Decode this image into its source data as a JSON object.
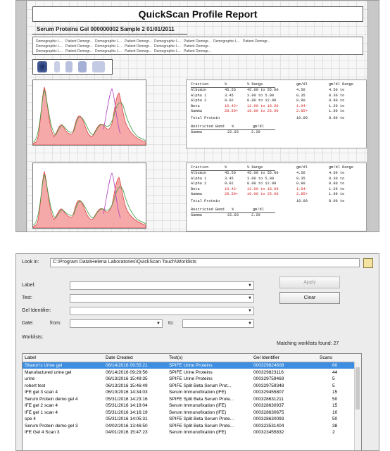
{
  "report": {
    "title": "QuickScan Profile Report",
    "subtitle": "Serum Proteins  Gel 000000002  Sample 2  01/01/2011",
    "demographics_row1": [
      "Demographic L...",
      "Patient Demogr...",
      "Demographic L...",
      "Patient Demogr...",
      "Demographic L...",
      "Patient Demogr...",
      "Demographic L...",
      "Patient Demogr..."
    ],
    "demographics_row2": [
      "Demographic L...",
      "Patient Demogr...",
      "Demographic L...",
      "Patient Demogr...",
      "Demographic L...",
      "Patient Demogr..."
    ],
    "demographics_row3": [
      "Demographic L...",
      "Patient Demogr...",
      "Demographic L...",
      "Patient Demogr...",
      "Demographic L...",
      "Patient Demogr..."
    ],
    "table_headers": [
      "Fraction",
      "%",
      "% Range",
      "gm/dl",
      "gm/dl Range"
    ],
    "tables": [
      {
        "rows": [
          {
            "fraction": "Albumin",
            "pct": "45.55",
            "range": "45.00 to  55.00",
            "gm": "4.56",
            "gmrange": "4.50 to",
            "abnormal": false
          },
          {
            "fraction": "Alpha 1",
            "pct": "3.45",
            "range": "3.00 to   5.00",
            "gm": "0.35",
            "gmrange": "0.30 to",
            "abnormal": false
          },
          {
            "fraction": "Alpha 2",
            "pct": "9.02",
            "range": "8.00 to  12.00",
            "gm": "0.90",
            "gmrange": "0.80 to",
            "abnormal": false
          },
          {
            "fraction": "Beta",
            "pct": "10.42+",
            "range": "12.00 to  18.00",
            "gm": "1.04-",
            "gmrange": "1.20 to",
            "abnormal": true
          },
          {
            "fraction": "Gamma",
            "pct": "28.50+",
            "range": "16.00 to  25.00",
            "gm": "2.85+",
            "gmrange": "1.60 to",
            "abnormal": true
          }
        ],
        "total_label": "Total Protein",
        "total_gm": "10.00",
        "total_range": "8.00 to",
        "restricted_label": "Restricted Band",
        "restricted_headers": [
          "%",
          "gm/dl"
        ],
        "restricted_fraction": "Gamma",
        "restricted_pct": "22.03",
        "restricted_gm": "2.20"
      },
      {
        "rows": [
          {
            "fraction": "Albumin",
            "pct": "45.50",
            "range": "45.00 to  55.00",
            "gm": "4.56",
            "gmrange": "4.50 to",
            "abnormal": false
          },
          {
            "fraction": "Alpha 1",
            "pct": "3.45",
            "range": "3.00 to   5.00",
            "gm": "0.35",
            "gmrange": "0.30 to",
            "abnormal": false
          },
          {
            "fraction": "Alpha 2",
            "pct": "9.02",
            "range": "8.00 to  12.00",
            "gm": "0.90",
            "gmrange": "0.80 to",
            "abnormal": false
          },
          {
            "fraction": "Beta",
            "pct": "10.42-",
            "range": "12.00 to  18.00",
            "gm": "1.04-",
            "gmrange": "1.20 to",
            "abnormal": true
          },
          {
            "fraction": "Gamma",
            "pct": "28.50+",
            "range": "16.00 to  25.00",
            "gm": "2.85+",
            "gmrange": "1.60 to",
            "abnormal": true
          }
        ],
        "total_label": "Total Protein",
        "total_gm": "10.00",
        "total_range": "8.00 to",
        "restricted_label": "Restricted Band",
        "restricted_headers": [
          "%",
          "gm/dl"
        ],
        "restricted_fraction": "Gamma",
        "restricted_pct": "22.03",
        "restricted_gm": "2.20"
      }
    ]
  },
  "dialog": {
    "look_in_label": "Look in:",
    "look_in_path": "C:\\Program Data\\Helena Laboratories\\QuickScan Touch\\Worklists",
    "label_label": "Label:",
    "test_label": "Test:",
    "gel_id_label": "Gel Identifier:",
    "date_label": "Date:",
    "from_label": "from:",
    "to_label": "to:",
    "apply_button": "Apply",
    "clear_button": "Clear",
    "worklists_label": "Worklists:",
    "matching_text": "Matching worklists found:  27",
    "columns": [
      "Label",
      "Date Created",
      "Test(s)",
      "Gel Identifier",
      "Scans"
    ],
    "rows": [
      {
        "label": "Sharon's Urine gel",
        "date": "06/14/2016  09:55:21",
        "test": "SPIFE Urine Proteins",
        "gel": "000329824608",
        "scans": "60",
        "selected": true
      },
      {
        "label": "Manufactured urine gel",
        "date": "06/14/2016  09:29:56",
        "test": "SPIFE Urine Proteins",
        "gel": "000329823116",
        "scans": "44",
        "selected": false
      },
      {
        "label": "urine",
        "date": "06/13/2016  15:49:35",
        "test": "SPIFE Urine Proteins",
        "gel": "000329759469",
        "scans": "5",
        "selected": false
      },
      {
        "label": "robert test",
        "date": "06/13/2016  15:46:49",
        "test": "SPIFE Split Beta Serum Prot...",
        "gel": "000329759348",
        "scans": "5",
        "selected": false
      },
      {
        "label": "IFE gel 3 scan 4",
        "date": "06/10/2016  14:34:03",
        "test": "Serum Immunofixation (IFE)",
        "gel": "000329455807",
        "scans": "15",
        "selected": false
      },
      {
        "label": "Serum Protein demo gel 4",
        "date": "05/31/2016  14:23:16",
        "test": "SPIFE Split Beta Serum Prote...",
        "gel": "000328631211",
        "scans": "50",
        "selected": false
      },
      {
        "label": "IFE gel 2 scan 4",
        "date": "05/31/2016  14:19:04",
        "test": "Serum Immunofixation (IFE)",
        "gel": "000328630937",
        "scans": "15",
        "selected": false
      },
      {
        "label": "IFE gel 1 scan 4",
        "date": "05/31/2016  14:16:19",
        "test": "Serum Immunofixation (IFE)",
        "gel": "000328630675",
        "scans": "10",
        "selected": false
      },
      {
        "label": "spe 4",
        "date": "05/31/2016  14:05:31",
        "test": "SPIFE Split Beta Serum Prote...",
        "gel": "000328630093",
        "scans": "50",
        "selected": false
      },
      {
        "label": "Serum Protein demo gel 3",
        "date": "04/02/2016  13:46:50",
        "test": "SPIFE Split Beta Serum Prote...",
        "gel": "000323531404",
        "scans": "38",
        "selected": false
      },
      {
        "label": "IFE Gel 4 Scan 3",
        "date": "04/01/2016  15:47:23",
        "test": "Serum Immunofixation (IFE)",
        "gel": "000323455832",
        "scans": "2",
        "selected": false
      }
    ]
  }
}
